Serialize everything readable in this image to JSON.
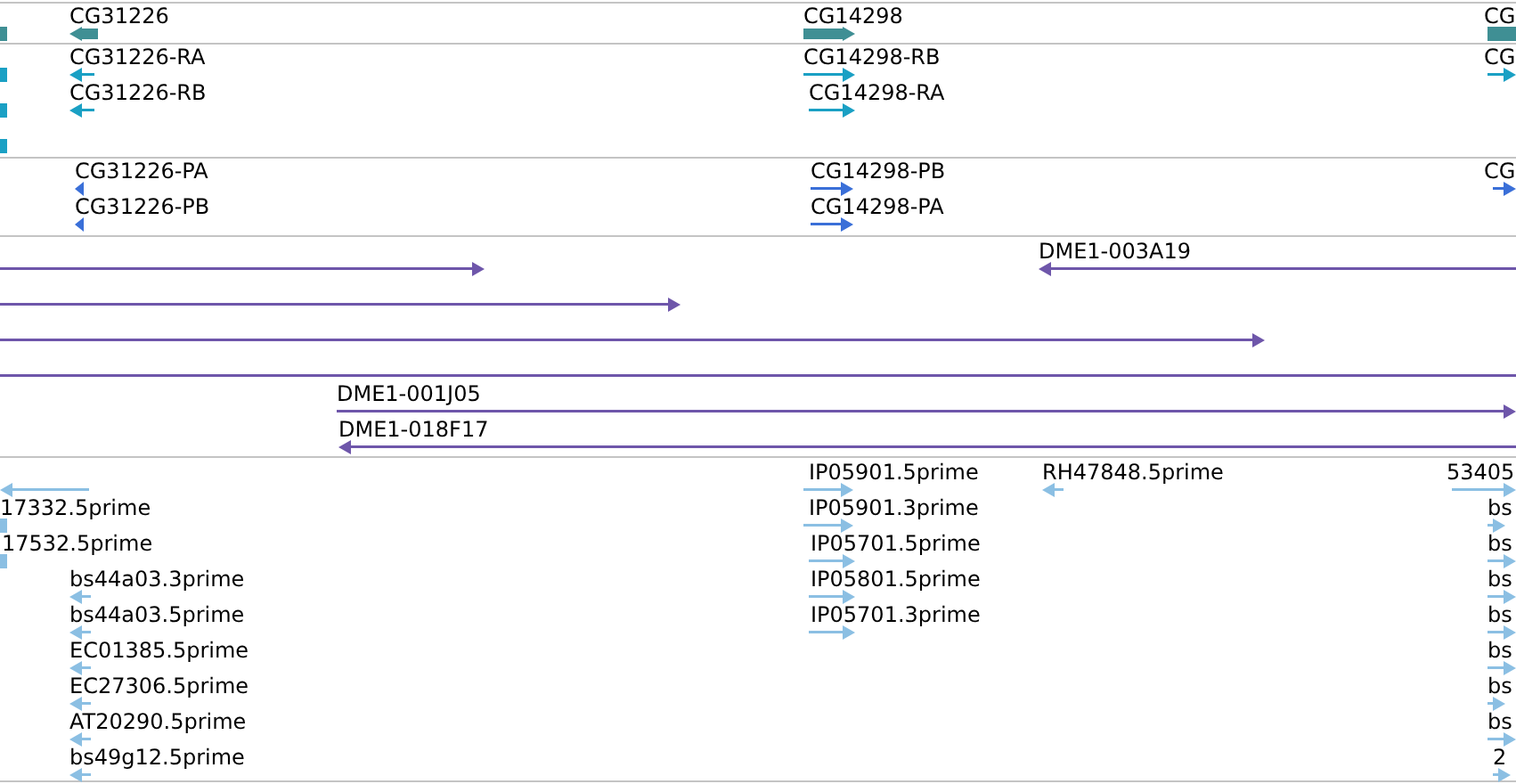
{
  "tracks": [
    {
      "kind": "gene",
      "features": [
        {
          "kind": "block"
        },
        {
          "kind": "arrow",
          "label": "CG31226",
          "forward": false
        },
        {
          "kind": "arrow",
          "label": "CG14298",
          "forward": true
        },
        {
          "kind": "block",
          "label": "CG"
        }
      ]
    },
    {
      "kind": "transcript",
      "features": [
        {
          "kind": "block"
        },
        {
          "kind": "block"
        },
        {
          "kind": "block"
        },
        {
          "kind": "arrow",
          "label": "CG31226-RA",
          "forward": false
        },
        {
          "kind": "arrow",
          "label": "CG31226-RB",
          "forward": false
        },
        {
          "kind": "arrow",
          "label": "CG14298-RB",
          "forward": true
        },
        {
          "kind": "arrow",
          "label": "CG14298-RA",
          "forward": true
        },
        {
          "kind": "arrow",
          "label": "CG",
          "forward": true
        }
      ]
    },
    {
      "kind": "protein",
      "features": [
        {
          "kind": "arrow",
          "label": "CG31226-PA",
          "forward": false
        },
        {
          "kind": "arrow",
          "label": "CG31226-PB",
          "forward": false
        },
        {
          "kind": "arrow",
          "label": "CG14298-PB",
          "forward": true
        },
        {
          "kind": "arrow",
          "label": "CG14298-PA",
          "forward": true
        },
        {
          "kind": "arrow",
          "label": "CG",
          "forward": true
        }
      ]
    },
    {
      "kind": "clone",
      "features": [
        {
          "kind": "arrow",
          "forward": true
        },
        {
          "kind": "arrow",
          "label": "DME1-003A19",
          "forward": false
        },
        {
          "kind": "arrow",
          "forward": true
        },
        {
          "kind": "arrow",
          "forward": true
        },
        {
          "kind": "block"
        },
        {
          "kind": "arrow",
          "label": "DME1-001J05",
          "forward": true
        },
        {
          "kind": "arrow",
          "label": "DME1-018F17",
          "forward": false
        }
      ]
    },
    {
      "kind": "est",
      "features": [
        {
          "kind": "arrow",
          "forward": false
        },
        {
          "kind": "block",
          "label": "17332.5prime"
        },
        {
          "kind": "block",
          "label": "17532.5prime"
        },
        {
          "kind": "arrow",
          "label": "bs44a03.3prime",
          "forward": false
        },
        {
          "kind": "arrow",
          "label": "bs44a03.5prime",
          "forward": false
        },
        {
          "kind": "arrow",
          "label": "EC01385.5prime",
          "forward": false
        },
        {
          "kind": "arrow",
          "label": "EC27306.5prime",
          "forward": false
        },
        {
          "kind": "arrow",
          "label": "AT20290.5prime",
          "forward": false
        },
        {
          "kind": "arrow",
          "label": "bs49g12.5prime",
          "forward": false
        },
        {
          "kind": "arrow",
          "label": "IP05901.5prime",
          "forward": true
        },
        {
          "kind": "arrow",
          "label": "IP05901.3prime",
          "forward": true
        },
        {
          "kind": "arrow",
          "label": "IP05701.5prime",
          "forward": true
        },
        {
          "kind": "arrow",
          "label": "IP05801.5prime",
          "forward": true
        },
        {
          "kind": "arrow",
          "label": "IP05701.3prime",
          "forward": true
        },
        {
          "kind": "arrow",
          "label": "RH47848.5prime",
          "forward": false
        },
        {
          "kind": "arrow",
          "label": "53405",
          "forward": true
        },
        {
          "kind": "arrow",
          "label": "bs",
          "forward": true
        },
        {
          "kind": "arrow",
          "label": "bs",
          "forward": true
        },
        {
          "kind": "arrow",
          "label": "bs",
          "forward": true
        },
        {
          "kind": "arrow",
          "label": "bs",
          "forward": true
        },
        {
          "kind": "arrow",
          "label": "bs",
          "forward": true
        },
        {
          "kind": "arrow",
          "label": "bs",
          "forward": true
        },
        {
          "kind": "arrow",
          "label": "bs",
          "forward": true
        },
        {
          "kind": "arrow",
          "label": "2",
          "forward": true
        }
      ]
    }
  ]
}
